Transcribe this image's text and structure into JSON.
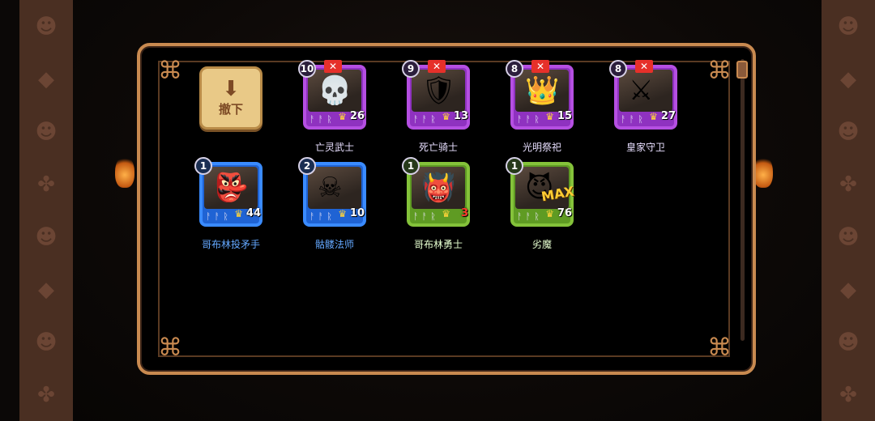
{
  "remove_button": {
    "label": "撤下",
    "icon": "down-arrow-icon"
  },
  "deployed_units": [
    {
      "name": "亡灵武士",
      "level": "10",
      "count": "26",
      "rarity": "purple",
      "icon": "undead-warrior-portrait"
    },
    {
      "name": "死亡骑士",
      "level": "9",
      "count": "13",
      "rarity": "purple",
      "icon": "death-knight-portrait"
    },
    {
      "name": "光明祭祀",
      "level": "8",
      "count": "15",
      "rarity": "purple",
      "icon": "light-priest-portrait"
    },
    {
      "name": "皇家守卫",
      "level": "8",
      "count": "27",
      "rarity": "purple",
      "icon": "royal-guard-portrait"
    }
  ],
  "reserve_units": [
    {
      "name": "哥布林投矛手",
      "level": "1",
      "count": "44",
      "rarity": "blue",
      "icon": "goblin-spearman-portrait"
    },
    {
      "name": "骷髅法师",
      "level": "2",
      "count": "10",
      "rarity": "blue",
      "icon": "skeleton-mage-portrait"
    },
    {
      "name": "哥布林勇士",
      "level": "1",
      "count": "3",
      "rarity": "green",
      "icon": "goblin-warrior-portrait"
    },
    {
      "name": "劣魔",
      "level": "1",
      "count": "76",
      "rarity": "green",
      "icon": "imp-portrait",
      "badge": "MAX"
    }
  ],
  "colors": {
    "purple": "#8f32c0",
    "blue": "#1f63d4",
    "green": "#5f9b23",
    "panel_border": "#c98a50",
    "cancel_red": "#e6302a"
  }
}
